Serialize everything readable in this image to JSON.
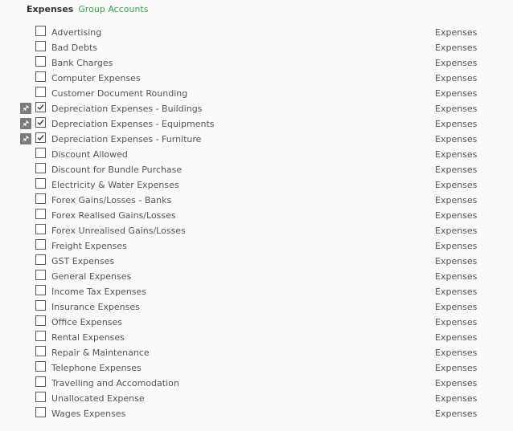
{
  "header": {
    "title": "Expenses",
    "link": "Group Accounts"
  },
  "rows": [
    {
      "name": "Advertising",
      "group": "Expenses",
      "checked": false,
      "pinned": false
    },
    {
      "name": "Bad Debts",
      "group": "Expenses",
      "checked": false,
      "pinned": false
    },
    {
      "name": "Bank Charges",
      "group": "Expenses",
      "checked": false,
      "pinned": false
    },
    {
      "name": "Computer Expenses",
      "group": "Expenses",
      "checked": false,
      "pinned": false
    },
    {
      "name": "Customer Document Rounding",
      "group": "Expenses",
      "checked": false,
      "pinned": false
    },
    {
      "name": "Depreciation Expenses - Buildings",
      "group": "Expenses",
      "checked": true,
      "pinned": true
    },
    {
      "name": "Depreciation Expenses - Equipments",
      "group": "Expenses",
      "checked": true,
      "pinned": true
    },
    {
      "name": "Depreciation Expenses - Furniture",
      "group": "Expenses",
      "checked": true,
      "pinned": true
    },
    {
      "name": "Discount Allowed",
      "group": "Expenses",
      "checked": false,
      "pinned": false
    },
    {
      "name": "Discount for Bundle Purchase",
      "group": "Expenses",
      "checked": false,
      "pinned": false
    },
    {
      "name": "Electricity & Water Expenses",
      "group": "Expenses",
      "checked": false,
      "pinned": false
    },
    {
      "name": "Forex Gains/Losses - Banks",
      "group": "Expenses",
      "checked": false,
      "pinned": false
    },
    {
      "name": "Forex Realised Gains/Losses",
      "group": "Expenses",
      "checked": false,
      "pinned": false
    },
    {
      "name": "Forex Unrealised Gains/Losses",
      "group": "Expenses",
      "checked": false,
      "pinned": false
    },
    {
      "name": "Freight Expenses",
      "group": "Expenses",
      "checked": false,
      "pinned": false
    },
    {
      "name": "GST Expenses",
      "group": "Expenses",
      "checked": false,
      "pinned": false
    },
    {
      "name": "General Expenses",
      "group": "Expenses",
      "checked": false,
      "pinned": false
    },
    {
      "name": "Income Tax Expenses",
      "group": "Expenses",
      "checked": false,
      "pinned": false
    },
    {
      "name": "Insurance Expenses",
      "group": "Expenses",
      "checked": false,
      "pinned": false
    },
    {
      "name": "Office Expenses",
      "group": "Expenses",
      "checked": false,
      "pinned": false
    },
    {
      "name": "Rental Expenses",
      "group": "Expenses",
      "checked": false,
      "pinned": false
    },
    {
      "name": "Repair & Maintenance",
      "group": "Expenses",
      "checked": false,
      "pinned": false
    },
    {
      "name": "Telephone Expenses",
      "group": "Expenses",
      "checked": false,
      "pinned": false
    },
    {
      "name": "Travelling and Accomodation",
      "group": "Expenses",
      "checked": false,
      "pinned": false
    },
    {
      "name": "Unallocated Expense",
      "group": "Expenses",
      "checked": false,
      "pinned": false
    },
    {
      "name": "Wages Expenses",
      "group": "Expenses",
      "checked": false,
      "pinned": false
    }
  ],
  "icons": {
    "pin": "pin-icon",
    "check": "checkmark-icon"
  },
  "colors": {
    "link": "#27a84a",
    "pin_bg": "#7b7b7b",
    "text": "#555555"
  }
}
